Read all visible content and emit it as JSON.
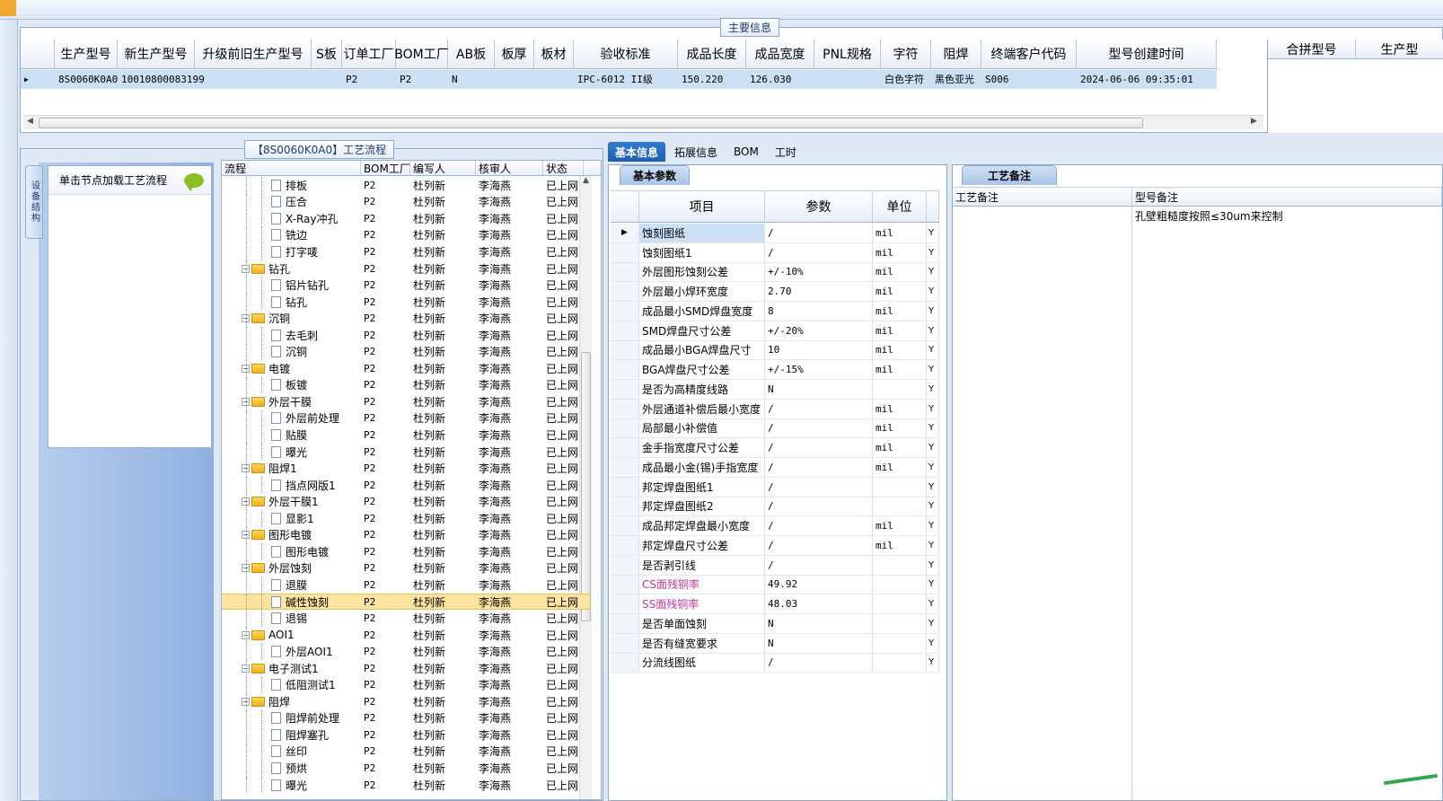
{
  "main_info": {
    "caption": "主要信息",
    "columns": [
      "生产型号",
      "新生产型号",
      "升级前旧生产型号",
      "S板",
      "订单工厂",
      "BOM工厂",
      "AB板",
      "板厚",
      "板材",
      "验收标准",
      "成品长度",
      "成品宽度",
      "PNL规格",
      "字符",
      "阻焊",
      "终端客户代码",
      "型号创建时间"
    ],
    "row": [
      "8S0060K0A0",
      "10010800083199",
      "",
      "",
      "P2",
      "P2",
      "N",
      "",
      "",
      "IPC-6012 II级",
      "150.220",
      "126.030",
      "",
      "白色字符",
      "黑色亚光",
      "S006",
      "2024-06-06 09:35:01"
    ],
    "right_columns": [
      "合拼型号",
      "生产型"
    ]
  },
  "process": {
    "caption": "【8S0060K0A0】工艺流程",
    "side_tab": "设备结构",
    "hint": "单击节点加载工艺流程",
    "columns": [
      "流程",
      "BOM工厂",
      "编写人",
      "核审人",
      "状态"
    ],
    "rows": [
      {
        "name": "排板",
        "level": 2,
        "bom": "P2",
        "author": "杜列新",
        "reviewer": "李海燕",
        "status": "已上网"
      },
      {
        "name": "压合",
        "level": 2,
        "bom": "P2",
        "author": "杜列新",
        "reviewer": "李海燕",
        "status": "已上网"
      },
      {
        "name": "X-Ray冲孔",
        "level": 2,
        "bom": "P2",
        "author": "杜列新",
        "reviewer": "李海燕",
        "status": "已上网"
      },
      {
        "name": "铣边",
        "level": 2,
        "bom": "P2",
        "author": "杜列新",
        "reviewer": "李海燕",
        "status": "已上网"
      },
      {
        "name": "打字唛",
        "level": 2,
        "bom": "P2",
        "author": "杜列新",
        "reviewer": "李海燕",
        "status": "已上网"
      },
      {
        "name": "钻孔",
        "level": 1,
        "bom": "P2",
        "author": "杜列新",
        "reviewer": "李海燕",
        "status": "已上网"
      },
      {
        "name": "铝片钻孔",
        "level": 2,
        "bom": "P2",
        "author": "杜列新",
        "reviewer": "李海燕",
        "status": "已上网"
      },
      {
        "name": "钻孔",
        "level": 2,
        "bom": "P2",
        "author": "杜列新",
        "reviewer": "李海燕",
        "status": "已上网"
      },
      {
        "name": "沉铜",
        "level": 1,
        "bom": "P2",
        "author": "杜列新",
        "reviewer": "李海燕",
        "status": "已上网"
      },
      {
        "name": "去毛刺",
        "level": 2,
        "bom": "P2",
        "author": "杜列新",
        "reviewer": "李海燕",
        "status": "已上网"
      },
      {
        "name": "沉铜",
        "level": 2,
        "bom": "P2",
        "author": "杜列新",
        "reviewer": "李海燕",
        "status": "已上网"
      },
      {
        "name": "电镀",
        "level": 1,
        "bom": "P2",
        "author": "杜列新",
        "reviewer": "李海燕",
        "status": "已上网"
      },
      {
        "name": "板镀",
        "level": 2,
        "bom": "P2",
        "author": "杜列新",
        "reviewer": "李海燕",
        "status": "已上网"
      },
      {
        "name": "外层干膜",
        "level": 1,
        "bom": "P2",
        "author": "杜列新",
        "reviewer": "李海燕",
        "status": "已上网"
      },
      {
        "name": "外层前处理",
        "level": 2,
        "bom": "P2",
        "author": "杜列新",
        "reviewer": "李海燕",
        "status": "已上网"
      },
      {
        "name": "贴膜",
        "level": 2,
        "bom": "P2",
        "author": "杜列新",
        "reviewer": "李海燕",
        "status": "已上网"
      },
      {
        "name": "曝光",
        "level": 2,
        "bom": "P2",
        "author": "杜列新",
        "reviewer": "李海燕",
        "status": "已上网"
      },
      {
        "name": "阻焊1",
        "level": 1,
        "bom": "P2",
        "author": "杜列新",
        "reviewer": "李海燕",
        "status": "已上网"
      },
      {
        "name": "挡点网版1",
        "level": 2,
        "bom": "P2",
        "author": "杜列新",
        "reviewer": "李海燕",
        "status": "已上网"
      },
      {
        "name": "外层干膜1",
        "level": 1,
        "bom": "P2",
        "author": "杜列新",
        "reviewer": "李海燕",
        "status": "已上网"
      },
      {
        "name": "显影1",
        "level": 2,
        "bom": "P2",
        "author": "杜列新",
        "reviewer": "李海燕",
        "status": "已上网"
      },
      {
        "name": "图形电镀",
        "level": 1,
        "bom": "P2",
        "author": "杜列新",
        "reviewer": "李海燕",
        "status": "已上网"
      },
      {
        "name": "图形电镀",
        "level": 2,
        "bom": "P2",
        "author": "杜列新",
        "reviewer": "李海燕",
        "status": "已上网"
      },
      {
        "name": "外层蚀刻",
        "level": 1,
        "bom": "P2",
        "author": "杜列新",
        "reviewer": "李海燕",
        "status": "已上网"
      },
      {
        "name": "退膜",
        "level": 2,
        "bom": "P2",
        "author": "杜列新",
        "reviewer": "李海燕",
        "status": "已上网"
      },
      {
        "name": "碱性蚀刻",
        "level": 2,
        "bom": "P2",
        "author": "杜列新",
        "reviewer": "李海燕",
        "status": "已上网",
        "selected": true
      },
      {
        "name": "退锡",
        "level": 2,
        "bom": "P2",
        "author": "杜列新",
        "reviewer": "李海燕",
        "status": "已上网"
      },
      {
        "name": "AOI1",
        "level": 1,
        "bom": "P2",
        "author": "杜列新",
        "reviewer": "李海燕",
        "status": "已上网"
      },
      {
        "name": "外层AOI1",
        "level": 2,
        "bom": "P2",
        "author": "杜列新",
        "reviewer": "李海燕",
        "status": "已上网"
      },
      {
        "name": "电子测试1",
        "level": 1,
        "bom": "P2",
        "author": "杜列新",
        "reviewer": "李海燕",
        "status": "已上网"
      },
      {
        "name": "低阻测试1",
        "level": 2,
        "bom": "P2",
        "author": "杜列新",
        "reviewer": "李海燕",
        "status": "已上网"
      },
      {
        "name": "阻焊",
        "level": 1,
        "bom": "P2",
        "author": "杜列新",
        "reviewer": "李海燕",
        "status": "已上网"
      },
      {
        "name": "阻焊前处理",
        "level": 2,
        "bom": "P2",
        "author": "杜列新",
        "reviewer": "李海燕",
        "status": "已上网"
      },
      {
        "name": "阻焊塞孔",
        "level": 2,
        "bom": "P2",
        "author": "杜列新",
        "reviewer": "李海燕",
        "status": "已上网"
      },
      {
        "name": "丝印",
        "level": 2,
        "bom": "P2",
        "author": "杜列新",
        "reviewer": "李海燕",
        "status": "已上网"
      },
      {
        "name": "预烘",
        "level": 2,
        "bom": "P2",
        "author": "杜列新",
        "reviewer": "李海燕",
        "status": "已上网"
      },
      {
        "name": "曝光",
        "level": 2,
        "bom": "P2",
        "author": "杜列新",
        "reviewer": "李海燕",
        "status": "已上网"
      }
    ]
  },
  "tabs": [
    "基本信息",
    "拓展信息",
    "BOM",
    "工时"
  ],
  "basic": {
    "tab": "基本参数",
    "columns": [
      "项目",
      "参数",
      "单位"
    ],
    "rows": [
      {
        "item": "蚀刻图纸",
        "value": "/",
        "unit": "mil",
        "flag": "Y",
        "selected": true
      },
      {
        "item": "蚀刻图纸1",
        "value": "/",
        "unit": "mil",
        "flag": "Y"
      },
      {
        "item": "外层图形蚀刻公差",
        "value": "+/-10%",
        "unit": "mil",
        "flag": "Y"
      },
      {
        "item": "外层最小焊环宽度",
        "value": "2.70",
        "unit": "mil",
        "flag": "Y"
      },
      {
        "item": "成品最小SMD焊盘宽度",
        "value": "8",
        "unit": "mil",
        "flag": "Y"
      },
      {
        "item": "SMD焊盘尺寸公差",
        "value": "+/-20%",
        "unit": "mil",
        "flag": "Y"
      },
      {
        "item": "成品最小BGA焊盘尺寸",
        "value": "10",
        "unit": "mil",
        "flag": "Y"
      },
      {
        "item": "BGA焊盘尺寸公差",
        "value": "+/-15%",
        "unit": "mil",
        "flag": "Y"
      },
      {
        "item": "是否为高精度线路",
        "value": "N",
        "unit": "",
        "flag": "Y"
      },
      {
        "item": "外层通道补偿后最小宽度",
        "value": "/",
        "unit": "mil",
        "flag": "Y"
      },
      {
        "item": "局部最小补偿值",
        "value": "/",
        "unit": "mil",
        "flag": "Y"
      },
      {
        "item": "金手指宽度尺寸公差",
        "value": "/",
        "unit": "mil",
        "flag": "Y"
      },
      {
        "item": "成品最小金(锡)手指宽度",
        "value": "/",
        "unit": "mil",
        "flag": "Y"
      },
      {
        "item": "邦定焊盘图纸1",
        "value": "/",
        "unit": "",
        "flag": "Y"
      },
      {
        "item": "邦定焊盘图纸2",
        "value": "/",
        "unit": "",
        "flag": "Y"
      },
      {
        "item": "成品邦定焊盘最小宽度",
        "value": "/",
        "unit": "mil",
        "flag": "Y"
      },
      {
        "item": "邦定焊盘尺寸公差",
        "value": "/",
        "unit": "mil",
        "flag": "Y"
      },
      {
        "item": "是否剥引线",
        "value": "/",
        "unit": "",
        "flag": "Y"
      },
      {
        "item": "CS面残铜率",
        "value": "49.92",
        "unit": "",
        "flag": "Y",
        "highlight": true
      },
      {
        "item": "SS面残铜率",
        "value": "48.03",
        "unit": "",
        "flag": "Y",
        "highlight": true
      },
      {
        "item": "是否单面蚀刻",
        "value": "N",
        "unit": "",
        "flag": "Y"
      },
      {
        "item": "是否有缝宽要求",
        "value": "N",
        "unit": "",
        "flag": "Y"
      },
      {
        "item": "分流线图纸",
        "value": "/",
        "unit": "",
        "flag": "Y"
      }
    ]
  },
  "remarks": {
    "tab": "工艺备注",
    "columns": [
      "工艺备注",
      "型号备注"
    ],
    "model_remark": "孔壁粗糙度按照≤30um来控制"
  },
  "colors": {
    "accent": "#1f5fae",
    "selection": "#cce0f5",
    "tree_selection": "#fbe4a0",
    "highlight_text": "#c0389c"
  },
  "icons": [
    "folder-icon",
    "document-icon",
    "chat-bubble-icon",
    "expand-collapse-icon",
    "scroll-arrow-icon"
  ]
}
